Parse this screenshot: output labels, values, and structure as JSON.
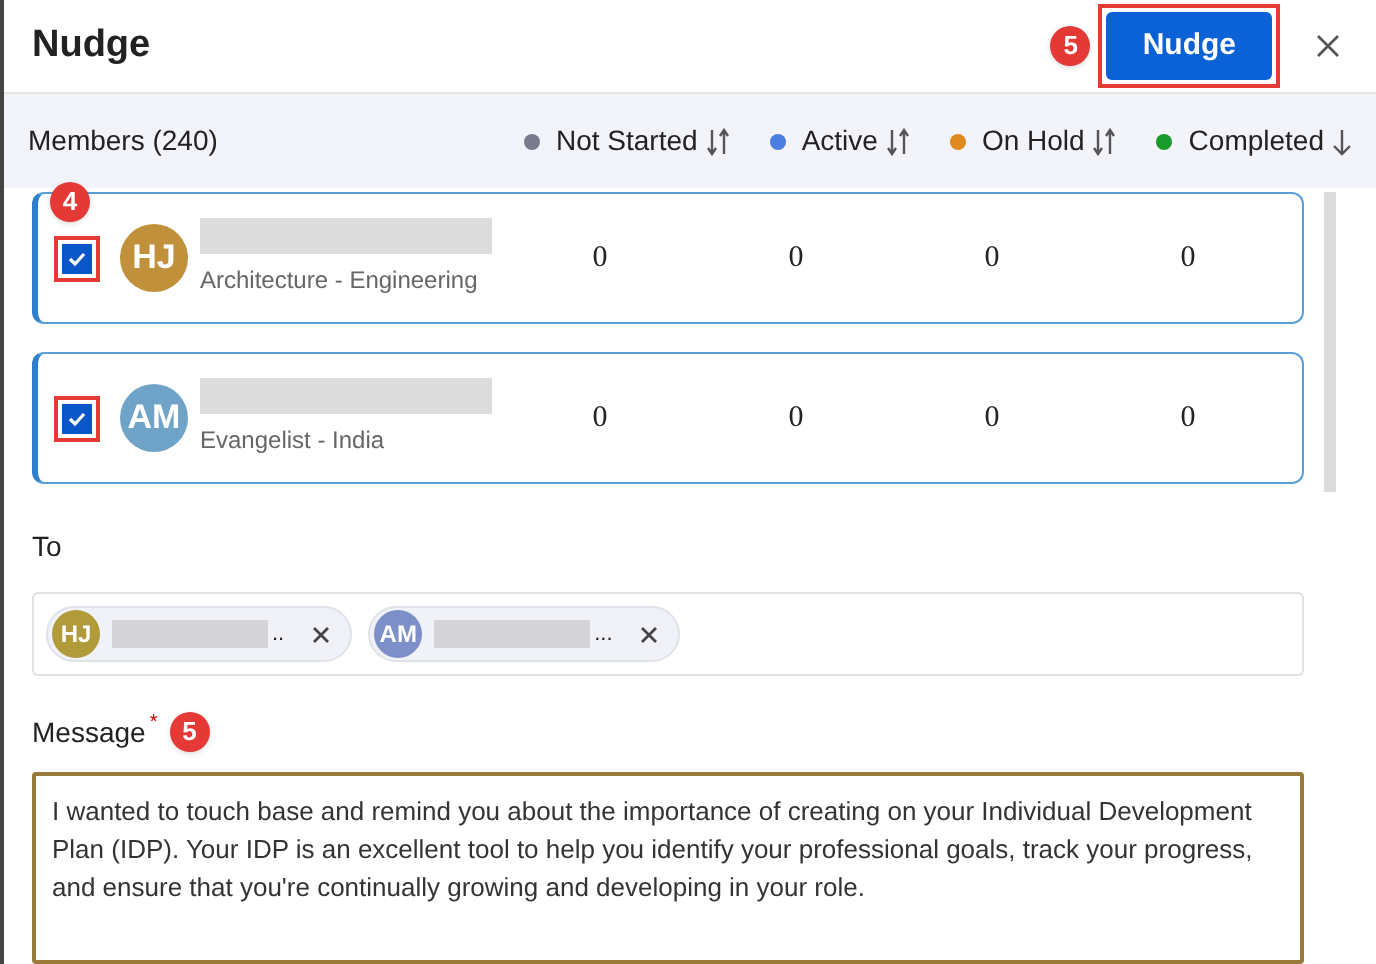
{
  "dialog": {
    "title": "Nudge",
    "button_callout": "5",
    "primary_button": "Nudge"
  },
  "members_header": {
    "label": "Members (240)",
    "columns": [
      {
        "label": "Not Started",
        "color": "#7a7a8c",
        "kind": "sortable"
      },
      {
        "label": "Active",
        "color": "#4a7ee0",
        "kind": "sortable"
      },
      {
        "label": "On Hold",
        "color": "#e08a1e",
        "kind": "sortable"
      },
      {
        "label": "Completed",
        "color": "#1a9a2a",
        "kind": "sorted"
      }
    ]
  },
  "members": [
    {
      "initials": "HJ",
      "color": "#c0903a",
      "subtitle": "Architecture - Engineering",
      "checked": true,
      "callout": "4",
      "counts": [
        "0",
        "0",
        "0",
        "0"
      ]
    },
    {
      "initials": "AM",
      "color": "#6fa3c8",
      "subtitle": "Evangelist - India",
      "checked": true,
      "counts": [
        "0",
        "0",
        "0",
        "0"
      ]
    }
  ],
  "to": {
    "label": "To",
    "chips": [
      {
        "initials": "HJ",
        "color": "#b09a3a",
        "ellipsis": ".."
      },
      {
        "initials": "AM",
        "color": "#7c8fc8",
        "ellipsis": "..."
      }
    ]
  },
  "message": {
    "label": "Message",
    "required_mark": "*",
    "callout": "5",
    "value": "I wanted to touch base and remind you about the importance of creating on your Individual Development Plan (IDP). Your IDP is an excellent tool to help you identify your professional goals, track your progress, and ensure that you're continually growing and developing in your role."
  }
}
